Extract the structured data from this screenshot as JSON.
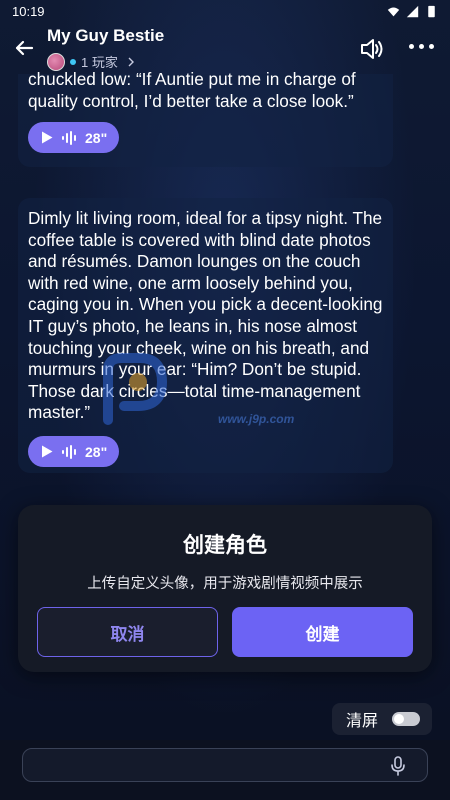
{
  "status_bar": {
    "time": "10:19"
  },
  "header": {
    "title": "My Guy Bestie",
    "players": "1 玩家"
  },
  "messages": [
    {
      "text": "chuckled low: “If Auntie put me in charge of quality control, I’d better take a close look.”",
      "voice_duration": "28\""
    },
    {
      "text": "Dimly lit living room, ideal for a tipsy night. The coffee table is covered with blind date photos and résumés. Damon lounges on the couch with red wine, one arm loosely behind you, caging you in. When you pick a decent-looking IT guy’s photo, he leans in, his nose almost touching your cheek, wine on his breath, and murmurs in your ear: “Him? Don’t be stupid. Those dark circles—total time-management master.”",
      "voice_duration": "28\""
    }
  ],
  "watermark": {
    "text": "www.j9p.com"
  },
  "dialog": {
    "title": "创建角色",
    "description": "上传自定义头像，用于游戏剧情视频中展示",
    "cancel_label": "取消",
    "create_label": "创建"
  },
  "clear_screen": {
    "label": "清屏",
    "on": false
  },
  "input": {
    "placeholder": ""
  },
  "colors": {
    "accent": "#6c63f4",
    "voice_pill": "#7a6ff0",
    "background": "#0d1427",
    "online_dot": "#3fc7f5"
  }
}
